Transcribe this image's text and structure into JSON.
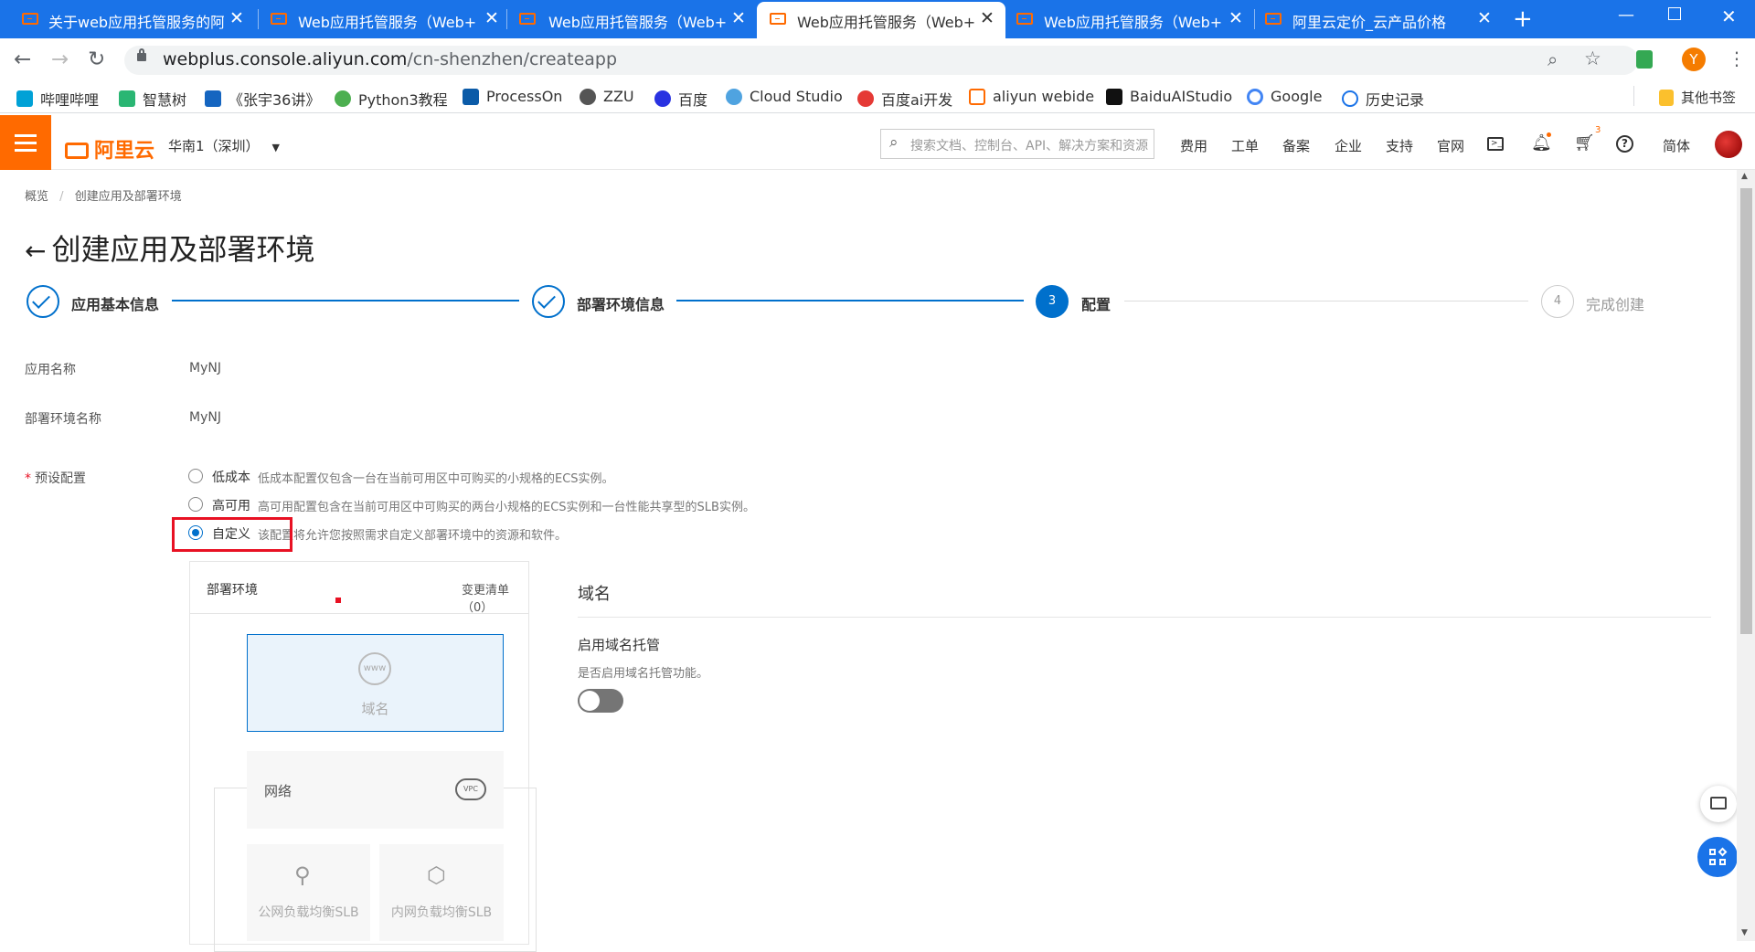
{
  "browser": {
    "tabs": [
      {
        "title": "关于web应用托管服务的阿里",
        "active": false
      },
      {
        "title": "Web应用托管服务（Web+）",
        "active": false
      },
      {
        "title": "Web应用托管服务（Web+）",
        "active": false
      },
      {
        "title": "Web应用托管服务（Web+）",
        "active": true
      },
      {
        "title": "Web应用托管服务（Web+）",
        "active": false
      },
      {
        "title": "阿里云定价_云产品价格",
        "active": false
      }
    ],
    "url_host": "webplus.console.aliyun.com",
    "url_path": "/cn-shenzhen/createapp",
    "profile_initial": "Y",
    "bookmarks": [
      "哔哩哔哩",
      "智慧树",
      "《张宇36讲》",
      "Python3教程",
      "ProcessOn",
      "ZZU",
      "百度",
      "Cloud Studio",
      "百度ai开发",
      "aliyun webide",
      "BaiduAIStudio",
      "Google",
      "历史记录"
    ],
    "other_bookmarks": "其他书签"
  },
  "console": {
    "logo_text": "阿里云",
    "region": "华南1（深圳）",
    "search_placeholder": "搜索文档、控制台、API、解决方案和资源",
    "nav": [
      "费用",
      "工单",
      "备案",
      "企业",
      "支持",
      "官网"
    ],
    "cart_badge": "3",
    "language": "简体"
  },
  "page": {
    "breadcrumb_home": "概览",
    "breadcrumb_current": "创建应用及部署环境",
    "title": "创建应用及部署环境",
    "steps": [
      {
        "label": "应用基本信息",
        "state": "done"
      },
      {
        "label": "部署环境信息",
        "state": "done"
      },
      {
        "label": "配置",
        "state": "current",
        "number": "3"
      },
      {
        "label": "完成创建",
        "state": "pending",
        "number": "4"
      }
    ],
    "fields": {
      "app_name_label": "应用名称",
      "app_name_value": "MyNJ",
      "env_name_label": "部署环境名称",
      "env_name_value": "MyNJ",
      "preset_required": "*",
      "preset_label": "预设配置"
    },
    "presets": [
      {
        "name": "低成本",
        "desc": "低成本配置仅包含一台在当前可用区中可购买的小规格的ECS实例。",
        "selected": false
      },
      {
        "name": "高可用",
        "desc": "高可用配置包含在当前可用区中可购买的两台小规格的ECS实例和一台性能共享型的SLB实例。",
        "selected": false
      },
      {
        "name": "自定义",
        "desc": "该配置将允许您按照需求自定义部署环境中的资源和软件。",
        "selected": true
      }
    ],
    "env_panel": {
      "title": "部署环境",
      "changes": "变更清单（0）",
      "cards": {
        "domain": "域名",
        "network": "网络",
        "public_slb": "公网负载均衡SLB",
        "private_slb": "内网负载均衡SLB"
      }
    },
    "detail": {
      "section_title": "域名",
      "item_title": "启用域名托管",
      "item_desc": "是否启用域名托管功能。",
      "toggle_on": false
    }
  },
  "colors": {
    "brand": "#ff6a00",
    "primary": "#0070cc",
    "highlight_box": "#e81123",
    "chrome_tabbar": "#1a73e8"
  }
}
